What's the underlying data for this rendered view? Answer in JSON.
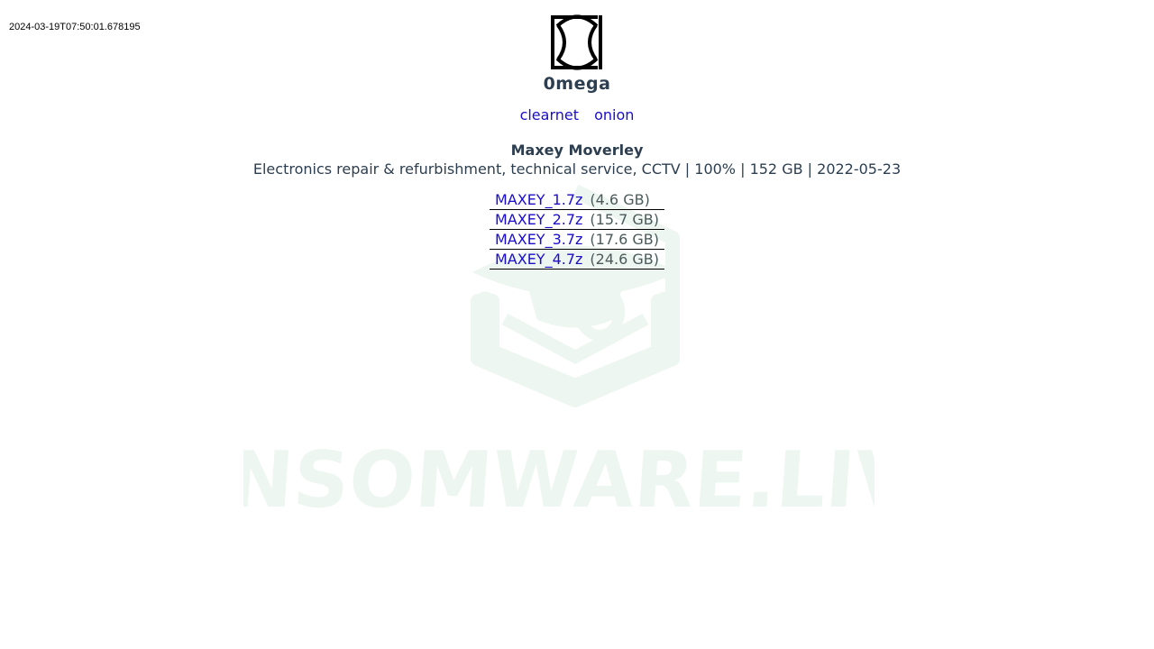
{
  "timestamp": "2024-03-19T07:50:01.678195",
  "watermark_text": "RANSOMWARE.LIVE",
  "group": {
    "name": "0mega",
    "logo_icon": "omega-icon"
  },
  "links": {
    "clearnet": "clearnet",
    "onion": "onion"
  },
  "victim": {
    "name": "Maxey Moverley",
    "description": "Electronics repair & refurbishment, technical service, CCTV | 100% | 152 GB | 2022-05-23"
  },
  "files": [
    {
      "name": "MAXEY_1.7z",
      "size": "(4.6 GB)"
    },
    {
      "name": "MAXEY_2.7z",
      "size": "(15.7 GB)"
    },
    {
      "name": "MAXEY_3.7z",
      "size": "(17.6 GB)"
    },
    {
      "name": "MAXEY_4.7z",
      "size": "(24.6 GB)"
    }
  ],
  "colors": {
    "text": "#2c3e50",
    "link": "#1a0dcc",
    "watermark": "#eef6f1"
  }
}
